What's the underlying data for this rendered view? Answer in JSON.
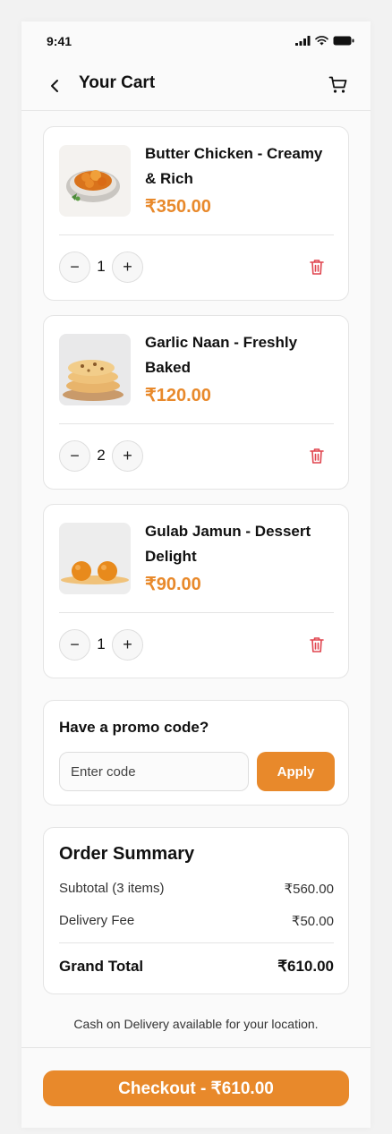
{
  "status_bar": {
    "time": "9:41"
  },
  "header": {
    "title": "Your Cart"
  },
  "cart": {
    "items": [
      {
        "name": "Butter Chicken - Creamy & Rich",
        "price": "₹350.00",
        "quantity": "1",
        "image_icon": "butter-chicken-image"
      },
      {
        "name": "Garlic Naan - Freshly Baked",
        "price": "₹120.00",
        "quantity": "2",
        "image_icon": "garlic-naan-image"
      },
      {
        "name": "Gulab Jamun - Dessert Delight",
        "price": "₹90.00",
        "quantity": "1",
        "image_icon": "gulab-jamun-image"
      }
    ],
    "decrement_label": "−",
    "increment_label": "+"
  },
  "promo": {
    "title": "Have a promo code?",
    "placeholder": "Enter code",
    "apply_label": "Apply"
  },
  "summary": {
    "title": "Order Summary",
    "subtotal_label": "Subtotal (3 items)",
    "subtotal_value": "₹560.00",
    "delivery_label": "Delivery Fee",
    "delivery_value": "₹50.00",
    "grand_total_label": "Grand Total",
    "grand_total_value": "₹610.00"
  },
  "cod_note": "Cash on Delivery available for your location.",
  "checkout": {
    "label": "Checkout - ₹610.00"
  },
  "colors": {
    "accent": "#e8892b",
    "danger": "#e0454f",
    "border": "#e4e4e4",
    "background": "#fafafa"
  }
}
